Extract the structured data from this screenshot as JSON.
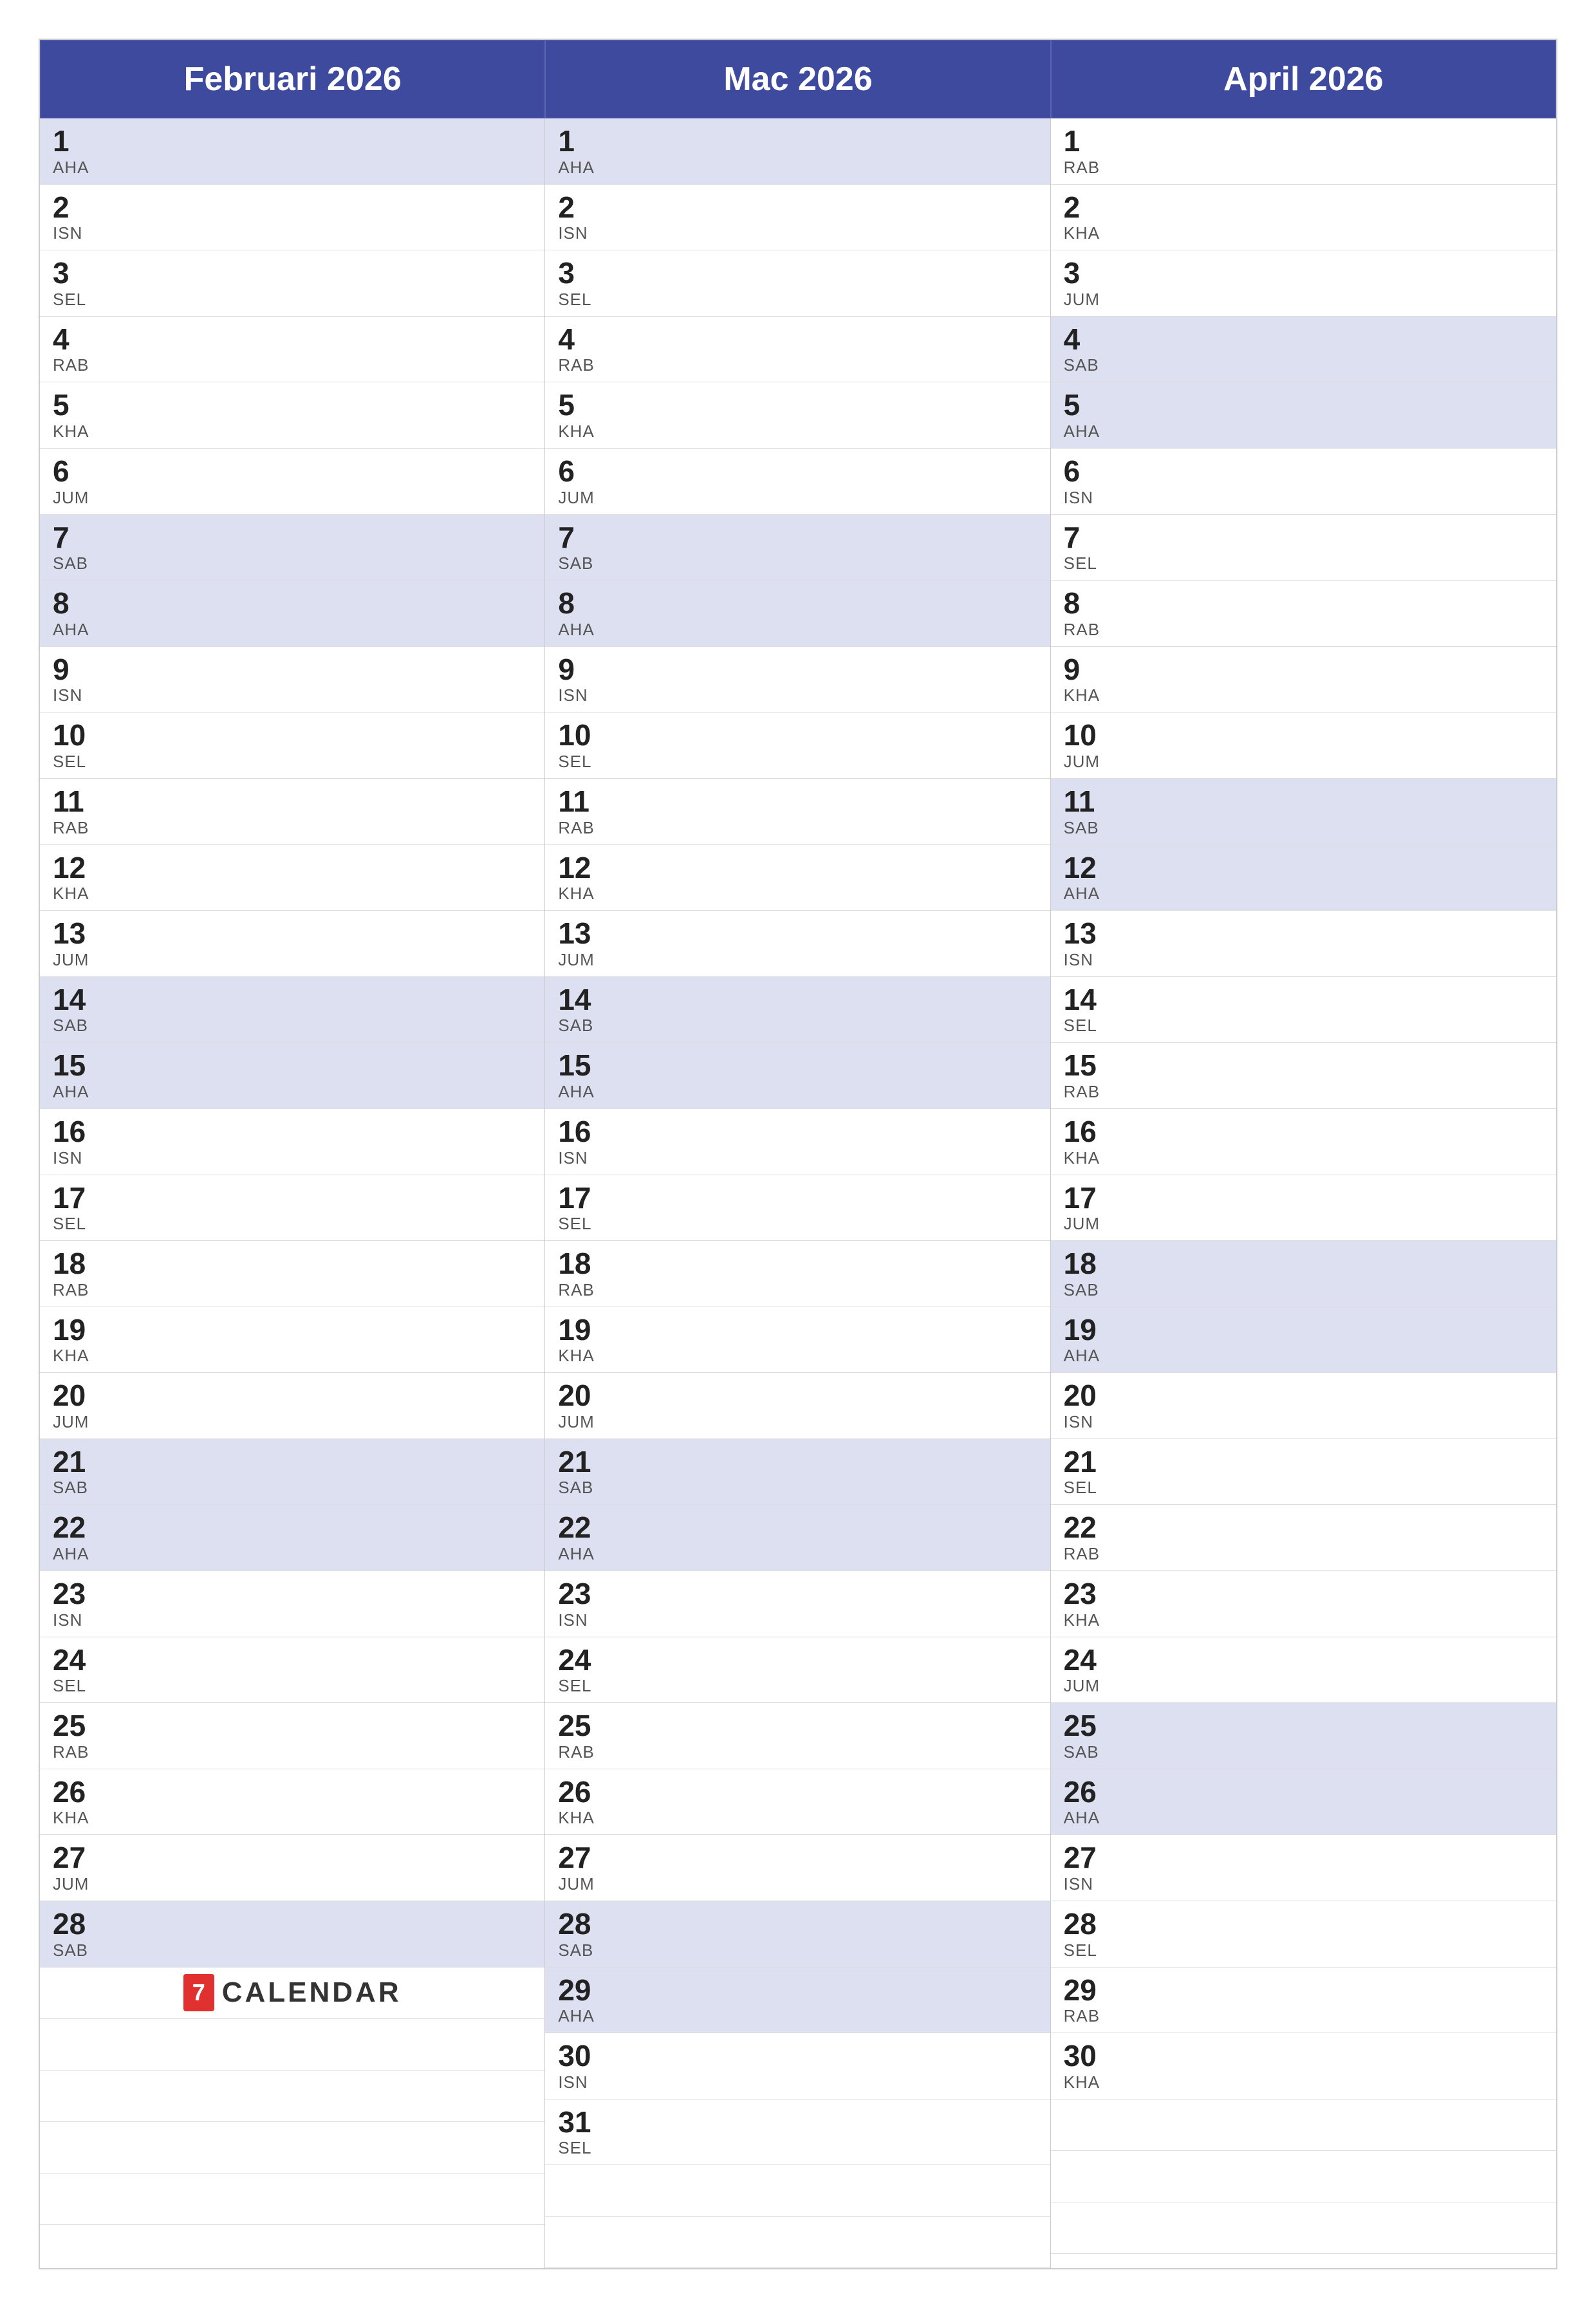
{
  "calendar": {
    "months": [
      {
        "name": "Februari 2026",
        "days": [
          {
            "num": "1",
            "day": "AHA",
            "weekend": true
          },
          {
            "num": "2",
            "day": "ISN",
            "weekend": false
          },
          {
            "num": "3",
            "day": "SEL",
            "weekend": false
          },
          {
            "num": "4",
            "day": "RAB",
            "weekend": false
          },
          {
            "num": "5",
            "day": "KHA",
            "weekend": false
          },
          {
            "num": "6",
            "day": "JUM",
            "weekend": false
          },
          {
            "num": "7",
            "day": "SAB",
            "weekend": true
          },
          {
            "num": "8",
            "day": "AHA",
            "weekend": true
          },
          {
            "num": "9",
            "day": "ISN",
            "weekend": false
          },
          {
            "num": "10",
            "day": "SEL",
            "weekend": false
          },
          {
            "num": "11",
            "day": "RAB",
            "weekend": false
          },
          {
            "num": "12",
            "day": "KHA",
            "weekend": false
          },
          {
            "num": "13",
            "day": "JUM",
            "weekend": false
          },
          {
            "num": "14",
            "day": "SAB",
            "weekend": true
          },
          {
            "num": "15",
            "day": "AHA",
            "weekend": true
          },
          {
            "num": "16",
            "day": "ISN",
            "weekend": false
          },
          {
            "num": "17",
            "day": "SEL",
            "weekend": false
          },
          {
            "num": "18",
            "day": "RAB",
            "weekend": false
          },
          {
            "num": "19",
            "day": "KHA",
            "weekend": false
          },
          {
            "num": "20",
            "day": "JUM",
            "weekend": false
          },
          {
            "num": "21",
            "day": "SAB",
            "weekend": true
          },
          {
            "num": "22",
            "day": "AHA",
            "weekend": true
          },
          {
            "num": "23",
            "day": "ISN",
            "weekend": false
          },
          {
            "num": "24",
            "day": "SEL",
            "weekend": false
          },
          {
            "num": "25",
            "day": "RAB",
            "weekend": false
          },
          {
            "num": "26",
            "day": "KHA",
            "weekend": false
          },
          {
            "num": "27",
            "day": "JUM",
            "weekend": false
          },
          {
            "num": "28",
            "day": "SAB",
            "weekend": true
          }
        ],
        "logo": true
      },
      {
        "name": "Mac 2026",
        "days": [
          {
            "num": "1",
            "day": "AHA",
            "weekend": true
          },
          {
            "num": "2",
            "day": "ISN",
            "weekend": false
          },
          {
            "num": "3",
            "day": "SEL",
            "weekend": false
          },
          {
            "num": "4",
            "day": "RAB",
            "weekend": false
          },
          {
            "num": "5",
            "day": "KHA",
            "weekend": false
          },
          {
            "num": "6",
            "day": "JUM",
            "weekend": false
          },
          {
            "num": "7",
            "day": "SAB",
            "weekend": true
          },
          {
            "num": "8",
            "day": "AHA",
            "weekend": true
          },
          {
            "num": "9",
            "day": "ISN",
            "weekend": false
          },
          {
            "num": "10",
            "day": "SEL",
            "weekend": false
          },
          {
            "num": "11",
            "day": "RAB",
            "weekend": false
          },
          {
            "num": "12",
            "day": "KHA",
            "weekend": false
          },
          {
            "num": "13",
            "day": "JUM",
            "weekend": false
          },
          {
            "num": "14",
            "day": "SAB",
            "weekend": true
          },
          {
            "num": "15",
            "day": "AHA",
            "weekend": true
          },
          {
            "num": "16",
            "day": "ISN",
            "weekend": false
          },
          {
            "num": "17",
            "day": "SEL",
            "weekend": false
          },
          {
            "num": "18",
            "day": "RAB",
            "weekend": false
          },
          {
            "num": "19",
            "day": "KHA",
            "weekend": false
          },
          {
            "num": "20",
            "day": "JUM",
            "weekend": false
          },
          {
            "num": "21",
            "day": "SAB",
            "weekend": true
          },
          {
            "num": "22",
            "day": "AHA",
            "weekend": true
          },
          {
            "num": "23",
            "day": "ISN",
            "weekend": false
          },
          {
            "num": "24",
            "day": "SEL",
            "weekend": false
          },
          {
            "num": "25",
            "day": "RAB",
            "weekend": false
          },
          {
            "num": "26",
            "day": "KHA",
            "weekend": false
          },
          {
            "num": "27",
            "day": "JUM",
            "weekend": false
          },
          {
            "num": "28",
            "day": "SAB",
            "weekend": true
          },
          {
            "num": "29",
            "day": "AHA",
            "weekend": true
          },
          {
            "num": "30",
            "day": "ISN",
            "weekend": false
          },
          {
            "num": "31",
            "day": "SEL",
            "weekend": false
          }
        ],
        "logo": false
      },
      {
        "name": "April 2026",
        "days": [
          {
            "num": "1",
            "day": "RAB",
            "weekend": false
          },
          {
            "num": "2",
            "day": "KHA",
            "weekend": false
          },
          {
            "num": "3",
            "day": "JUM",
            "weekend": false
          },
          {
            "num": "4",
            "day": "SAB",
            "weekend": true
          },
          {
            "num": "5",
            "day": "AHA",
            "weekend": true
          },
          {
            "num": "6",
            "day": "ISN",
            "weekend": false
          },
          {
            "num": "7",
            "day": "SEL",
            "weekend": false
          },
          {
            "num": "8",
            "day": "RAB",
            "weekend": false
          },
          {
            "num": "9",
            "day": "KHA",
            "weekend": false
          },
          {
            "num": "10",
            "day": "JUM",
            "weekend": false
          },
          {
            "num": "11",
            "day": "SAB",
            "weekend": true
          },
          {
            "num": "12",
            "day": "AHA",
            "weekend": true
          },
          {
            "num": "13",
            "day": "ISN",
            "weekend": false
          },
          {
            "num": "14",
            "day": "SEL",
            "weekend": false
          },
          {
            "num": "15",
            "day": "RAB",
            "weekend": false
          },
          {
            "num": "16",
            "day": "KHA",
            "weekend": false
          },
          {
            "num": "17",
            "day": "JUM",
            "weekend": false
          },
          {
            "num": "18",
            "day": "SAB",
            "weekend": true
          },
          {
            "num": "19",
            "day": "AHA",
            "weekend": true
          },
          {
            "num": "20",
            "day": "ISN",
            "weekend": false
          },
          {
            "num": "21",
            "day": "SEL",
            "weekend": false
          },
          {
            "num": "22",
            "day": "RAB",
            "weekend": false
          },
          {
            "num": "23",
            "day": "KHA",
            "weekend": false
          },
          {
            "num": "24",
            "day": "JUM",
            "weekend": false
          },
          {
            "num": "25",
            "day": "SAB",
            "weekend": true
          },
          {
            "num": "26",
            "day": "AHA",
            "weekend": true
          },
          {
            "num": "27",
            "day": "ISN",
            "weekend": false
          },
          {
            "num": "28",
            "day": "SEL",
            "weekend": false
          },
          {
            "num": "29",
            "day": "RAB",
            "weekend": false
          },
          {
            "num": "30",
            "day": "KHA",
            "weekend": false
          }
        ],
        "logo": false
      }
    ],
    "logo_text": "CALENDAR",
    "logo_number": "7"
  }
}
